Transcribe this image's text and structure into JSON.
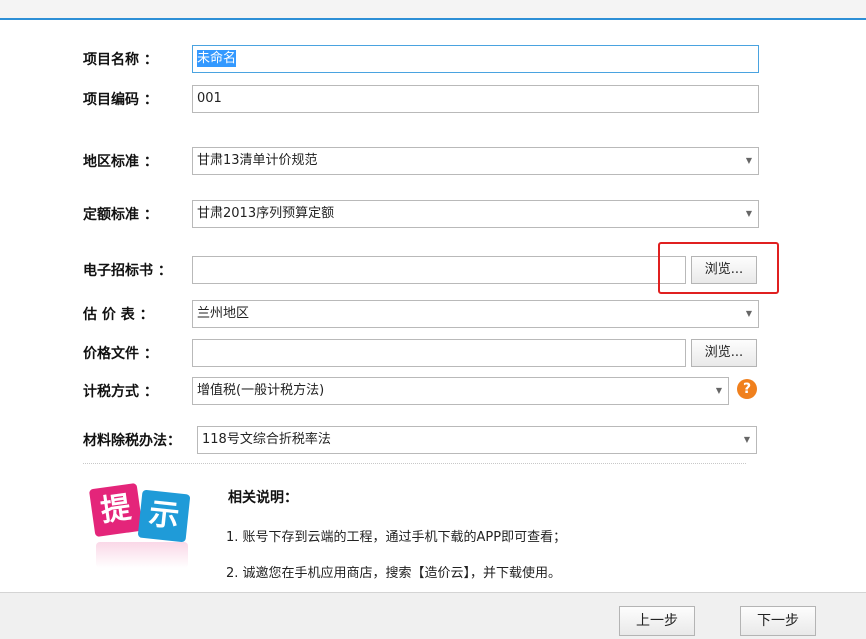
{
  "form": {
    "project_name": {
      "label": "项目名称 ：",
      "value": "未命名"
    },
    "project_code": {
      "label": "项目编码 ：",
      "value": "001"
    },
    "region_standard": {
      "label": "地区标准 ：",
      "value": "甘肃13清单计价规范"
    },
    "quota_standard": {
      "label": "定额标准 ：",
      "value": "甘肃2013序列预算定额"
    },
    "tender_doc": {
      "label": "电子招标书 ：",
      "value": "",
      "browse_label": "浏览..."
    },
    "valuation_table": {
      "label": "估 价 表 ：",
      "value": "兰州地区"
    },
    "price_file": {
      "label": "价格文件 ：",
      "value": "",
      "browse_label": "浏览..."
    },
    "tax_method": {
      "label": "计税方式 ：",
      "value": "增值税(一般计税方法)"
    },
    "material_tax": {
      "label": "材料除税办法：",
      "value": "118号文综合折税率法"
    }
  },
  "tip": {
    "logo_chars": [
      "提",
      "示"
    ],
    "title": "相关说明：",
    "lines": [
      "1. 账号下存到云端的工程，通过手机下载的APP即可查看；",
      "2. 诚邀您在手机应用商店，搜索【造价云】，并下载使用。"
    ]
  },
  "footer": {
    "prev_label": "上一步",
    "next_label": "下一步"
  },
  "colors": {
    "accent": "#2d8fd6",
    "highlight_box": "#e02020",
    "help_icon": "#f0801d",
    "tile_pink": "#e4257a",
    "tile_blue": "#1f9bd8"
  }
}
